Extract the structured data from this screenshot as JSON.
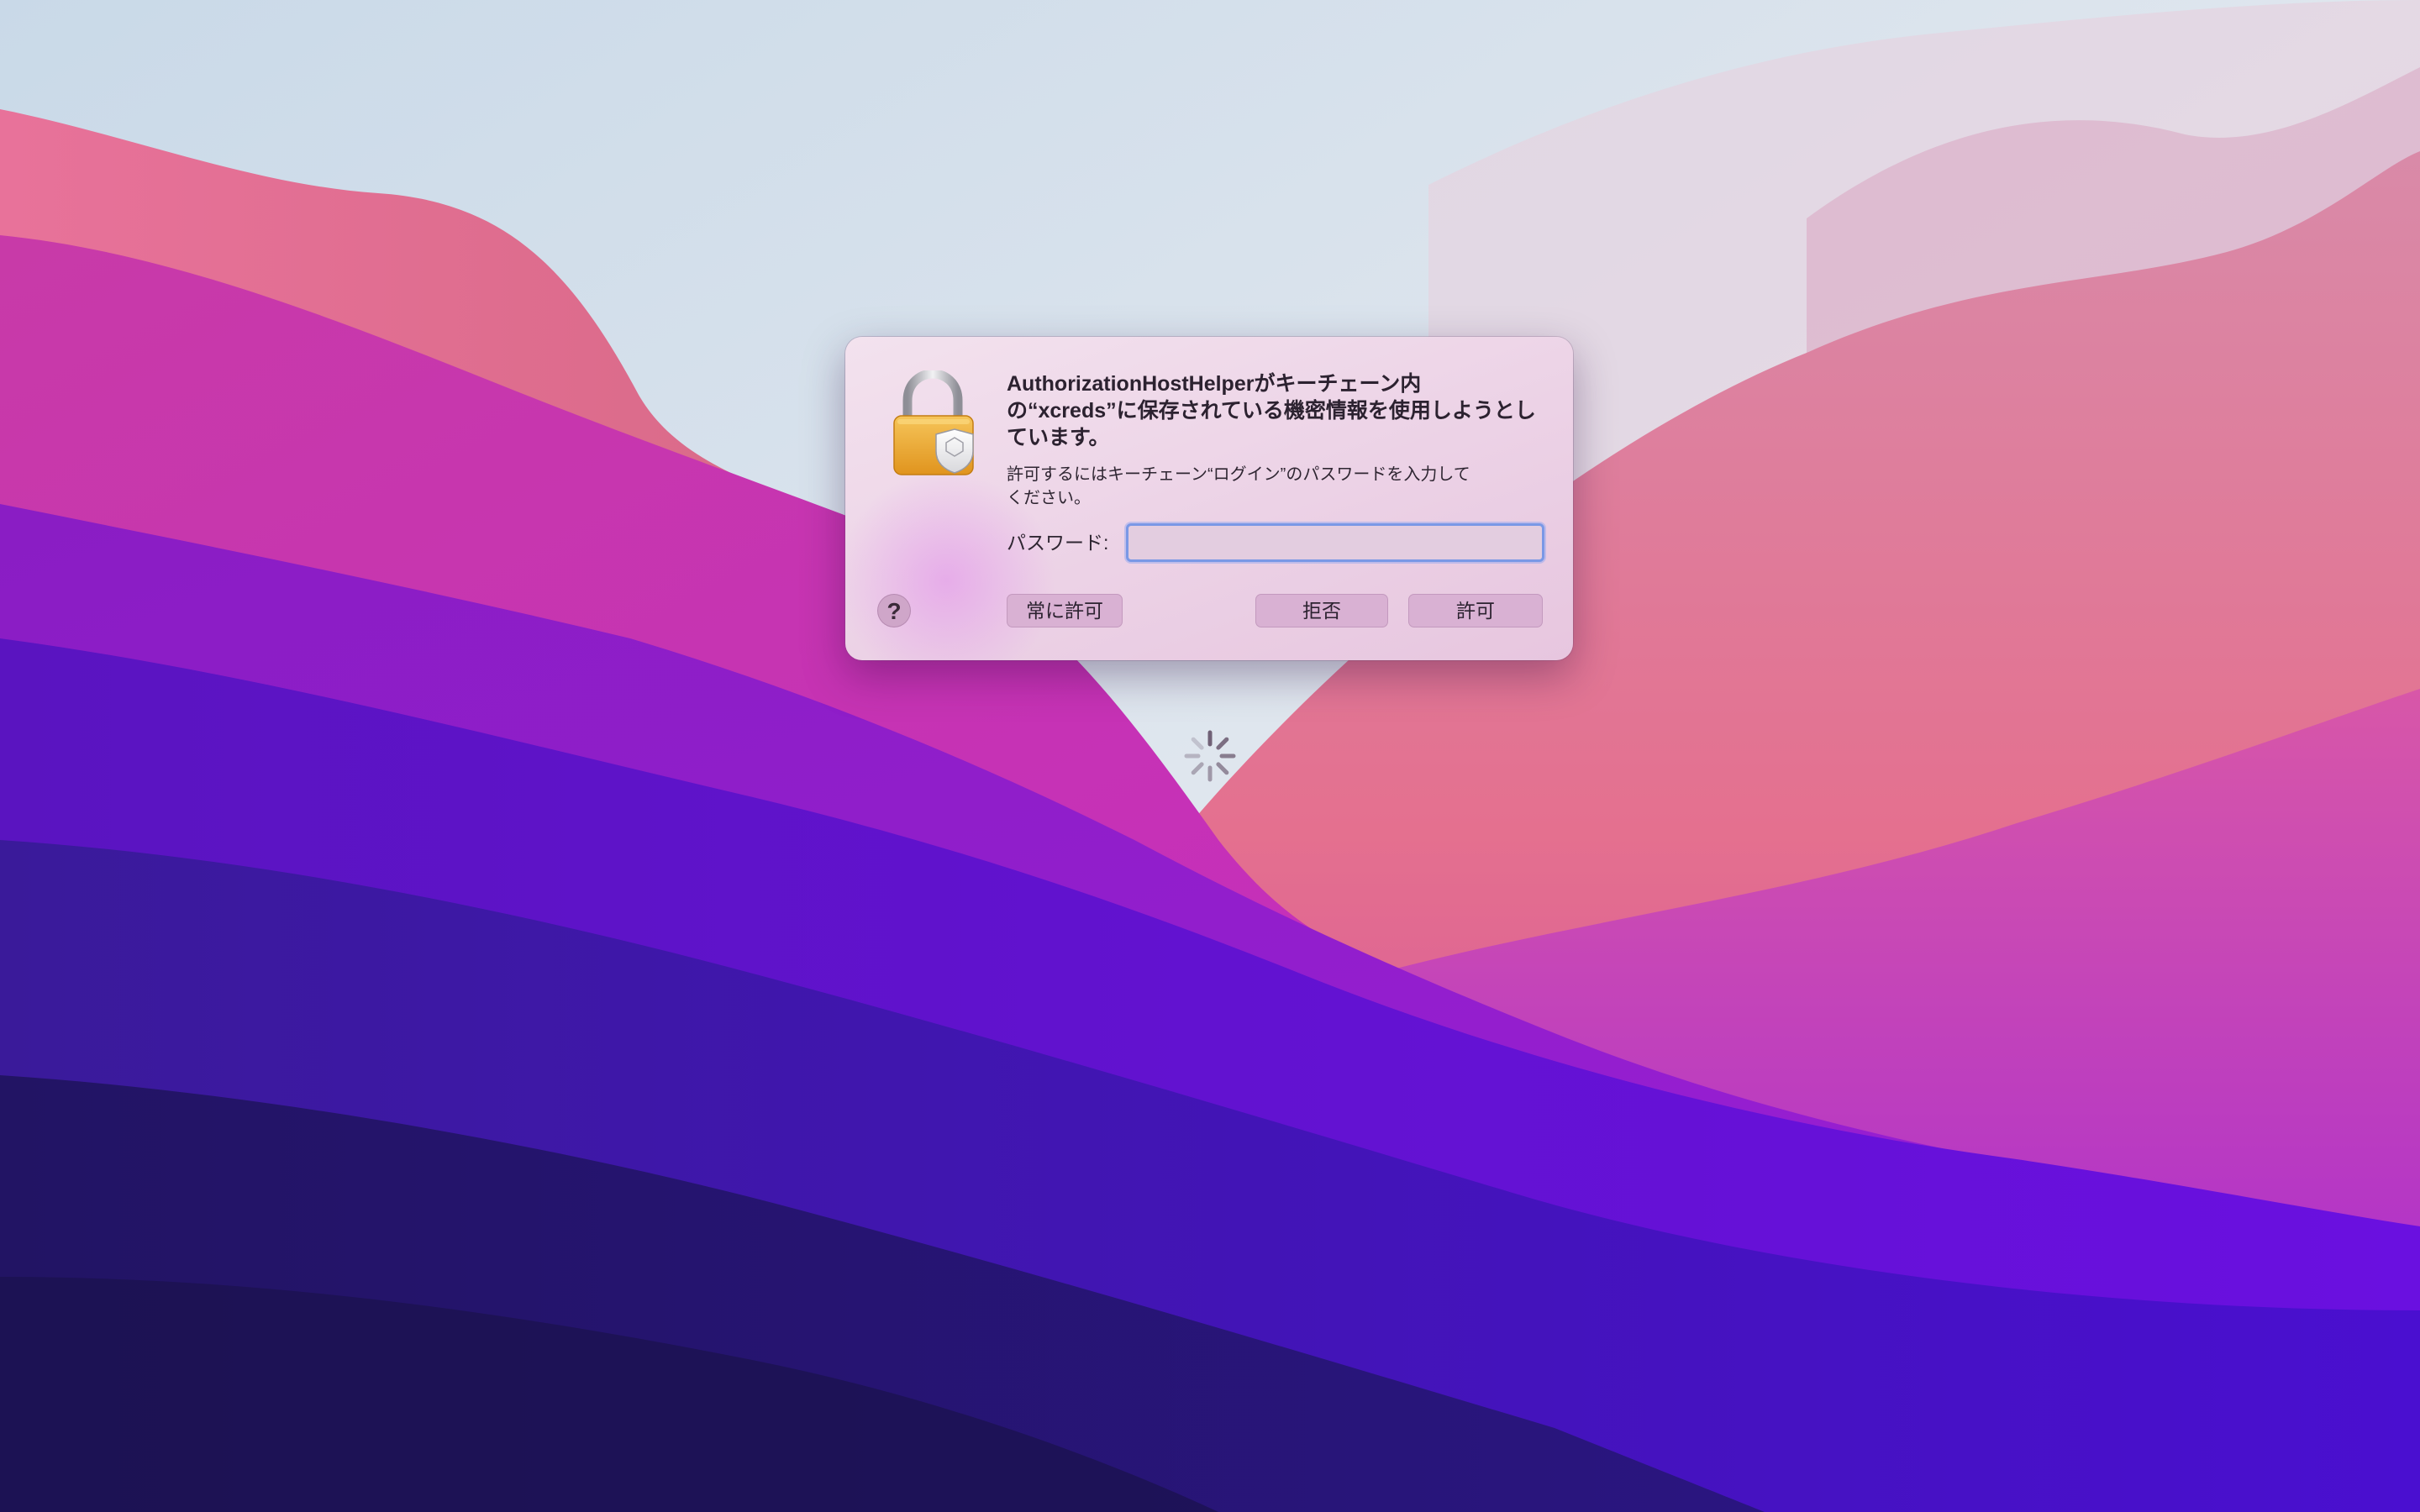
{
  "dialog": {
    "title_lines": [
      "AuthorizationHostHelperがキーチェーン内",
      "の“xcreds”に保存されている機密情報を使用しようとし",
      "ています。"
    ],
    "message_lines": [
      "許可するにはキーチェーン“ログイン”のパスワードを入力して",
      "ください。"
    ],
    "password_label": "パスワード:",
    "password_value": "",
    "help_label": "?",
    "buttons": {
      "always_allow": "常に許可",
      "deny": "拒否",
      "allow": "許可"
    },
    "icon": "keychain-lock-icon"
  },
  "desktop": {
    "wallpaper": "macos-monterey-wallpaper",
    "spinner": "loading-spinner-icon"
  },
  "colors": {
    "focus_ring": "#7a98e6",
    "dialog_background": "#efd9ea",
    "button_background": "#d9b1d3"
  }
}
